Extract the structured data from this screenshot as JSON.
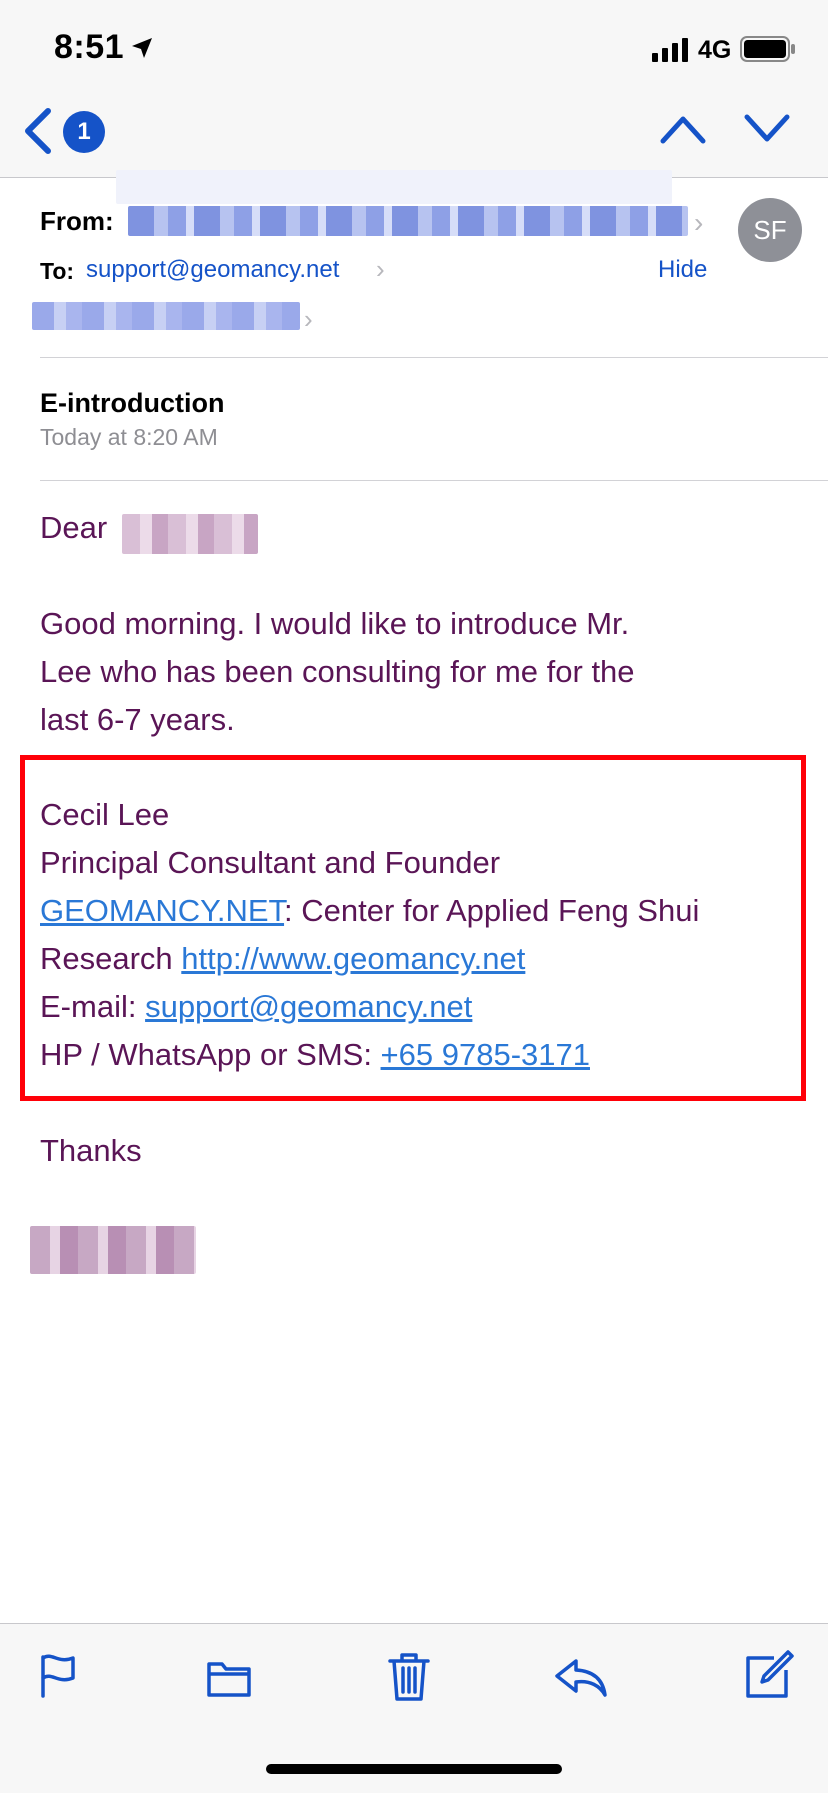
{
  "status_bar": {
    "time": "8:51",
    "network": "4G"
  },
  "nav": {
    "unread_count": "1"
  },
  "header": {
    "from_label": "From:",
    "sender_initials": "SF",
    "to_label": "To:",
    "to_address": "support@geomancy.net",
    "hide_label": "Hide"
  },
  "message": {
    "subject": "E-introduction",
    "date": "Today at 8:20 AM",
    "greeting": "Dear",
    "paragraph_lines": [
      "Good morning. I would like to introduce Mr.",
      "Lee who has been consulting for me for the",
      "last 6-7 years."
    ],
    "signature": {
      "name": "Cecil Lee",
      "title": "Principal Consultant and Founder",
      "org_link": "GEOMANCY.NET",
      "org_rest": ": Center for Applied Feng Shui",
      "research_label": "Research ",
      "website": "http://www.geomancy.net",
      "email_label": "E-mail: ",
      "email": "support@geomancy.net",
      "phone_label": "HP / WhatsApp or SMS: ",
      "phone": "+65 9785-3171"
    },
    "closing": "Thanks"
  },
  "colors": {
    "accent": "#1553c8",
    "body_text": "#5a1556",
    "link": "#2a78d6",
    "highlight_border": "#ff0008"
  },
  "toolbar_icons": [
    "flag-icon",
    "folder-icon",
    "trash-icon",
    "reply-icon",
    "compose-icon"
  ]
}
